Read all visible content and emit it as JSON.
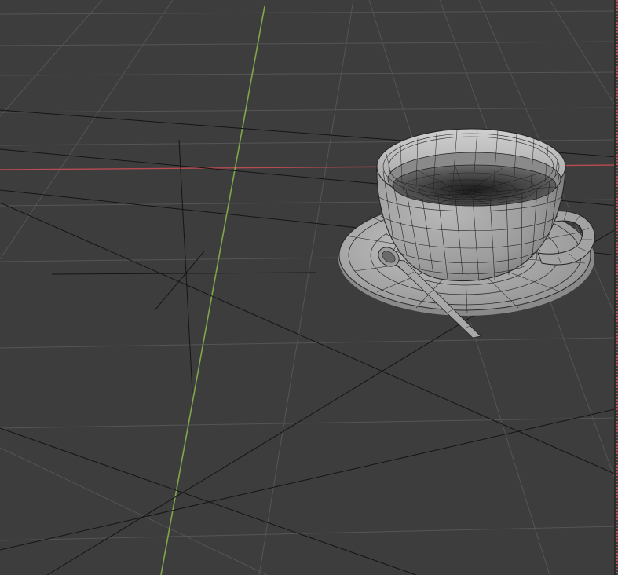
{
  "viewport": {
    "background": "#3d3d3d",
    "grid_color": "#545454",
    "axis_x_color": "#b84a52",
    "axis_y_color": "#7fa84a",
    "mesh_fill": "#9a9a9a",
    "wire_color": "#1a1a1a",
    "region_border_color": "#c85a5a"
  },
  "scene": {
    "objects": [
      "cup",
      "saucer",
      "spoon",
      "coffee-surface",
      "camera-lines"
    ]
  }
}
